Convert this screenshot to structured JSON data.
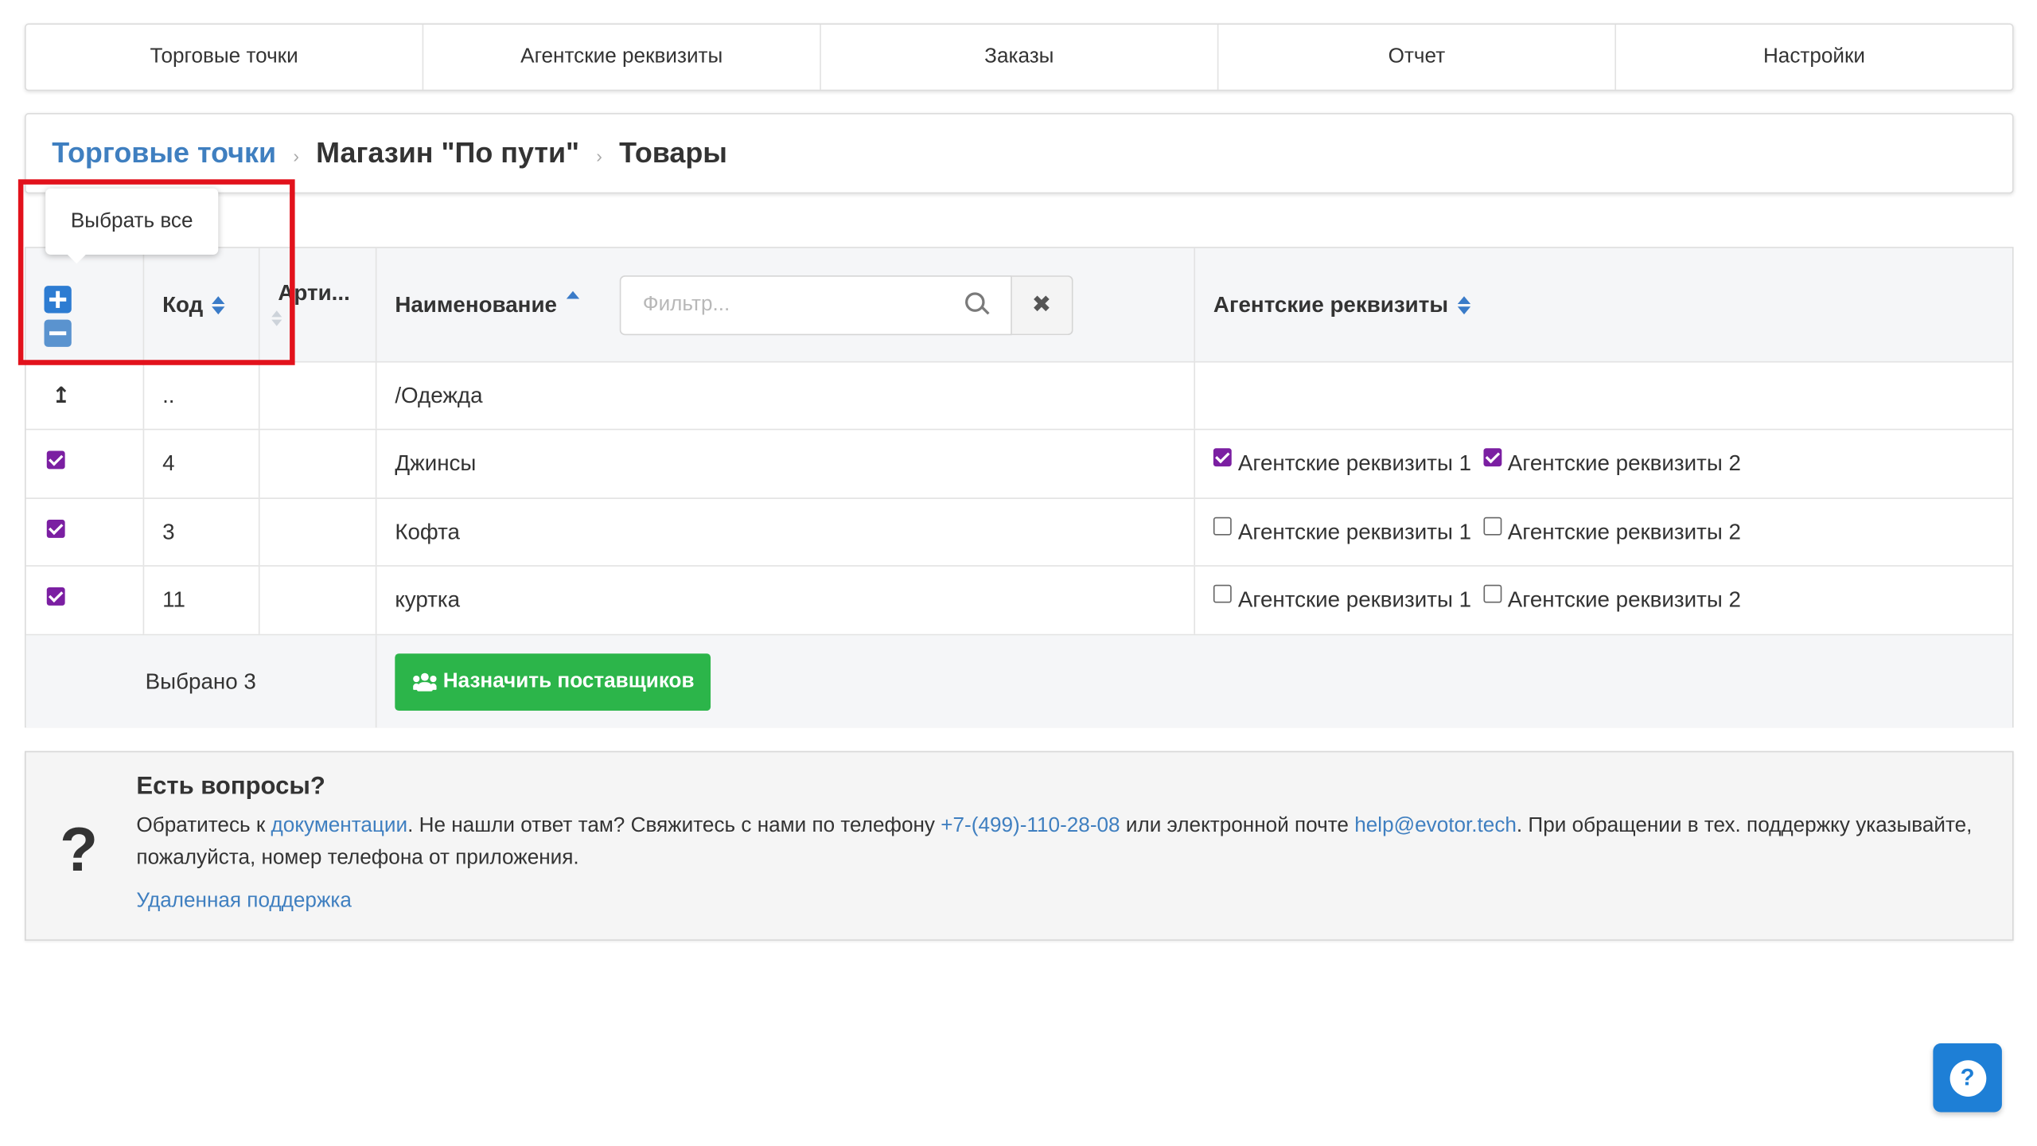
{
  "nav": {
    "items": [
      "Торговые точки",
      "Агентские реквизиты",
      "Заказы",
      "Отчет",
      "Настройки"
    ]
  },
  "breadcrumb": {
    "root": "Торговые точки",
    "store": "Магазин \"По пути\"",
    "current": "Товары",
    "separator": "›"
  },
  "tooltip": "Выбрать все",
  "table": {
    "headers": {
      "code": "Код",
      "article": "Арти...",
      "name": "Наименование",
      "agent": "Агентские реквизиты"
    },
    "filter_placeholder": "Фильтр...",
    "filter_clear": "✖",
    "up_row": {
      "icon": "↥",
      "code": "..",
      "name": "/Одежда"
    },
    "rows": [
      {
        "checked": true,
        "code": "4",
        "article": "",
        "name": "Джинсы",
        "agent1": "Агентские реквизиты 1",
        "agent1_checked": true,
        "agent2": "Агентские реквизиты 2",
        "agent2_checked": true
      },
      {
        "checked": true,
        "code": "3",
        "article": "",
        "name": "Кофта",
        "agent1": "Агентские реквизиты 1",
        "agent1_checked": false,
        "agent2": "Агентские реквизиты 2",
        "agent2_checked": false
      },
      {
        "checked": true,
        "code": "11",
        "article": "",
        "name": "куртка",
        "agent1": "Агентские реквизиты 1",
        "agent1_checked": false,
        "agent2": "Агентские реквизиты 2",
        "agent2_checked": false
      }
    ],
    "footer": {
      "selected": "Выбрано 3",
      "assign_button": "Назначить поставщиков"
    }
  },
  "help": {
    "question_mark": "?",
    "title": "Есть вопросы?",
    "text_1": "Обратитесь к ",
    "docs_link": "документации",
    "text_2": ". Не нашли ответ там? Свяжитесь с нами по телефону ",
    "phone": "+7-(499)-110-28-08",
    "text_3": " или электронной почте ",
    "email": "help@evotor.tech",
    "text_4": ". При обращении в тех. поддержку указывайте, пожалуйста, номер телефона от приложения.",
    "remote": "Удаленная поддержка"
  },
  "fab_icon": "?",
  "colors": {
    "link": "#3f7fc0",
    "sort_arrow": "#3a7bc8",
    "checkbox": "#7b1fa2",
    "assign_button": "#2cb54a",
    "highlight": "#e2121c",
    "fab": "#1e7fd6"
  }
}
